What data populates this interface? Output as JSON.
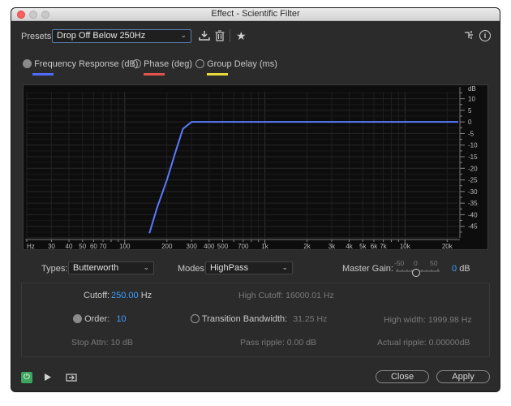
{
  "window": {
    "title": "Effect - Scientific Filter"
  },
  "presets": {
    "label": "Presets:",
    "value": "Drop Off Below 250Hz"
  },
  "toolbar": {
    "save_icon": "save-preset-icon",
    "delete_icon": "trash-icon",
    "favorite_icon": "star-icon",
    "routing_icon": "channel-routing-icon",
    "info_icon": "info-icon"
  },
  "display_modes": [
    {
      "label": "Frequency Response (dB)",
      "color": "#4f6bff",
      "selected": true
    },
    {
      "label": "Phase (deg)",
      "color": "#e0524c",
      "selected": false
    },
    {
      "label": "Group Delay (ms)",
      "color": "#e6d93a",
      "selected": false
    }
  ],
  "graph": {
    "x_labels": [
      "Hz",
      "30",
      "40",
      "50",
      "60",
      "70",
      "100",
      "200",
      "300",
      "400",
      "500",
      "700",
      "1k",
      "2k",
      "3k",
      "4k",
      "5k",
      "6k",
      "7k",
      "10k",
      "20k"
    ],
    "y_labels": [
      "dB",
      "10",
      "5",
      "0",
      "-5",
      "-10",
      "-15",
      "-20",
      "-25",
      "-30",
      "-35",
      "-40",
      "-45"
    ],
    "curve_color": "#5b79ff"
  },
  "chart_data": {
    "type": "line",
    "xlabel": "Hz",
    "ylabel": "dB",
    "x_scale": "log",
    "xlim": [
      20,
      24000
    ],
    "ylim": [
      -50,
      13
    ],
    "series": [
      {
        "x": [
          150,
          170,
          200,
          230,
          260,
          300,
          400,
          1000,
          10000,
          24000
        ],
        "y": [
          -48,
          -37,
          -25,
          -13,
          -3,
          0,
          0,
          0,
          0,
          0
        ]
      }
    ]
  },
  "controls": {
    "types_label": "Types:",
    "types_value": "Butterworth",
    "modes_label": "Modes:",
    "modes_value": "HighPass",
    "master_gain_label": "Master Gain:",
    "gain_scale": [
      "-50",
      "0",
      "50"
    ],
    "gain_value": "0",
    "gain_unit": "dB"
  },
  "params": {
    "cutoff_label": "Cutoff:",
    "cutoff_value": "250.00",
    "cutoff_unit": "Hz",
    "high_cutoff": "High Cutoff:  16000.01 Hz",
    "order_label": "Order:",
    "order_value": "10",
    "transition_label": "Transition Bandwidth:",
    "transition_value": "31.25 Hz",
    "high_width": "High width:  1999.98 Hz",
    "stop_attn": "Stop Attn:  10 dB",
    "pass_ripple": "Pass ripple:  0.00 dB",
    "actual_ripple": "Actual ripple:  0.00000dB"
  },
  "footer": {
    "close_label": "Close",
    "apply_label": "Apply",
    "power_icon": "power-icon",
    "play_icon": "play-icon",
    "export_icon": "export-icon"
  }
}
